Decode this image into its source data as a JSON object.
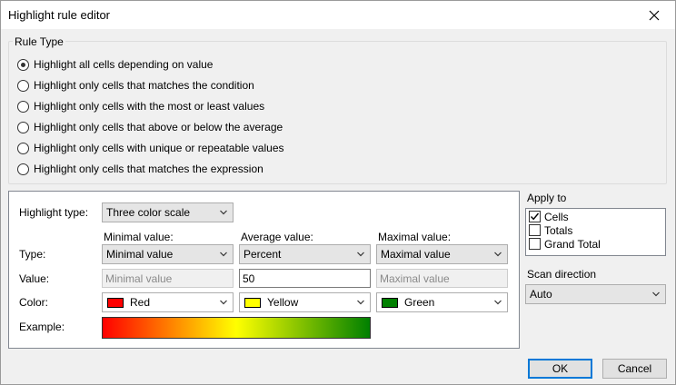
{
  "window": {
    "title": "Highlight rule editor",
    "close_icon": "close-icon"
  },
  "rule_type": {
    "legend": "Rule Type",
    "options": [
      {
        "label": "Highlight all cells depending on value",
        "checked": true
      },
      {
        "label": "Highlight only cells that matches the condition",
        "checked": false
      },
      {
        "label": "Highlight only cells with the most or least values",
        "checked": false
      },
      {
        "label": "Highlight only cells that above or below the average",
        "checked": false
      },
      {
        "label": "Highlight only cells with unique or repeatable values",
        "checked": false
      },
      {
        "label": "Highlight only cells that matches the expression",
        "checked": false
      }
    ]
  },
  "highlight": {
    "type_label": "Highlight type:",
    "type_value": "Three color scale",
    "row_labels": {
      "type": "Type:",
      "value": "Value:",
      "color": "Color:",
      "example": "Example:"
    },
    "columns": [
      {
        "header": "Minimal value:",
        "type": "Minimal value",
        "value": "Minimal value",
        "value_disabled": true,
        "color_name": "Red",
        "color_hex": "#ff0000"
      },
      {
        "header": "Average value:",
        "type": "Percent",
        "value": "50",
        "value_disabled": false,
        "color_name": "Yellow",
        "color_hex": "#ffff00"
      },
      {
        "header": "Maximal value:",
        "type": "Maximal value",
        "value": "Maximal value",
        "value_disabled": true,
        "color_name": "Green",
        "color_hex": "#008000"
      }
    ]
  },
  "apply_to": {
    "label": "Apply to",
    "items": [
      {
        "label": "Cells",
        "checked": true
      },
      {
        "label": "Totals",
        "checked": false
      },
      {
        "label": "Grand Total",
        "checked": false
      }
    ]
  },
  "scan_direction": {
    "label": "Scan direction",
    "value": "Auto"
  },
  "buttons": {
    "ok": "OK",
    "cancel": "Cancel"
  }
}
